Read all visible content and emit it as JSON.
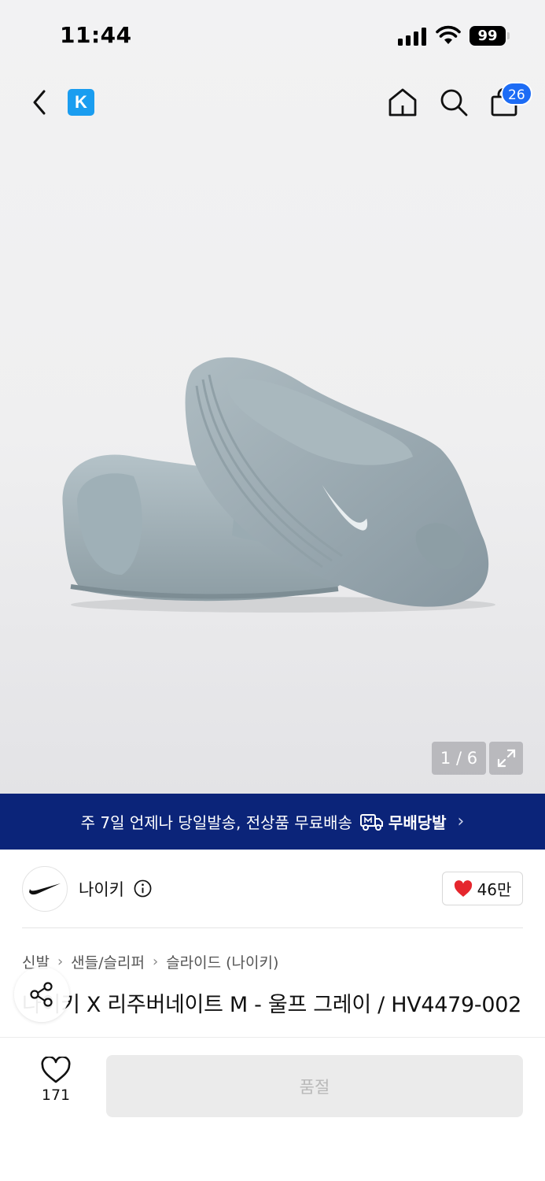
{
  "status_bar": {
    "time": "11:44",
    "battery": "99"
  },
  "top_bar": {
    "logo_letter": "K",
    "cart_count": "26"
  },
  "gallery": {
    "counter": "1 / 6"
  },
  "promo": {
    "text": "주 7일 언제나 당일발송, 전상품 무료배송",
    "brand": "무배당발",
    "arrow": "›"
  },
  "brand": {
    "name": "나이키",
    "likes": "46만"
  },
  "breadcrumb": [
    "신발",
    "샌들/슬리퍼",
    "슬라이드 (나이키)"
  ],
  "breadcrumb_sep": "›",
  "product": {
    "title": "나이키 X 리주버네이트 M - 울프 그레이 / HV4479-002"
  },
  "bottom": {
    "wish_count": "171",
    "buy_label": "품절"
  },
  "colors": {
    "promo_bg": "#0b2479",
    "badge": "#1d6cf5",
    "logo": "#1a9df0",
    "heart": "#e5262d"
  },
  "icons": [
    "back-icon",
    "home-icon",
    "search-icon",
    "bag-icon",
    "expand-icon",
    "delivery-truck-icon",
    "info-icon",
    "heart-filled-icon",
    "share-icon",
    "heart-outline-icon",
    "nike-swoosh-icon"
  ]
}
